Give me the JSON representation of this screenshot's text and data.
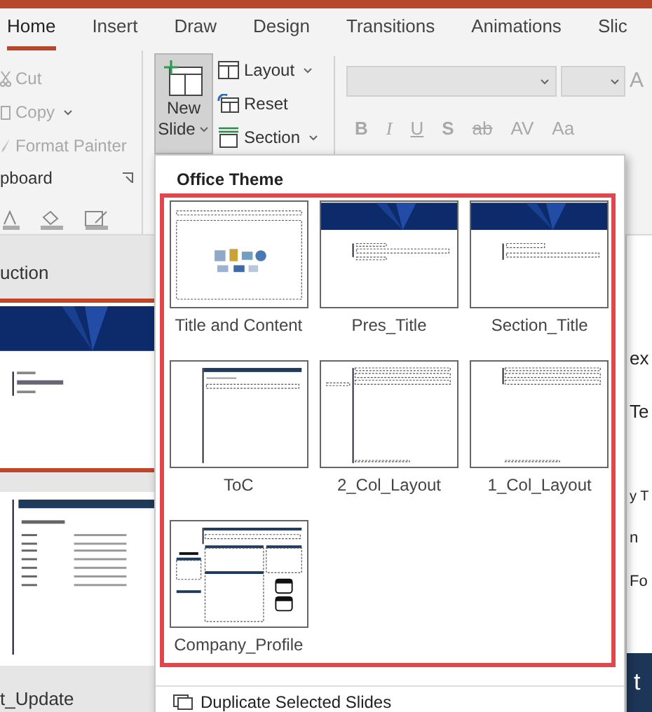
{
  "tabs": [
    {
      "label": "Home",
      "selected": true
    },
    {
      "label": "Insert",
      "selected": false
    },
    {
      "label": "Draw",
      "selected": false
    },
    {
      "label": "Design",
      "selected": false
    },
    {
      "label": "Transitions",
      "selected": false
    },
    {
      "label": "Animations",
      "selected": false
    },
    {
      "label": "Slic",
      "selected": false
    }
  ],
  "clipboard": {
    "items": [
      {
        "kind": "cut",
        "label": "Cut",
        "disabled": true,
        "caret": false
      },
      {
        "kind": "copy",
        "label": "Copy",
        "disabled": true,
        "caret": true
      },
      {
        "kind": "painter",
        "label": "Format Painter",
        "disabled": true,
        "caret": false
      }
    ],
    "group_label": "pboard"
  },
  "slides_group": {
    "new_slide": {
      "label": "New",
      "label2": "Slide",
      "expanded": true
    },
    "items": [
      {
        "kind": "layout",
        "label": "Layout"
      },
      {
        "kind": "reset",
        "label": "Reset"
      },
      {
        "kind": "section",
        "label": "Section"
      }
    ]
  },
  "font_group": {
    "disabled": true,
    "grow_label": "A",
    "buttons": [
      {
        "label": "B"
      },
      {
        "label": "I"
      },
      {
        "label": "U"
      },
      {
        "label": "S"
      },
      {
        "label": "ab"
      },
      {
        "label": "AV"
      },
      {
        "label": "Aa"
      }
    ]
  },
  "slide_panel": {
    "section_labels": [
      "uction",
      "t_Update"
    ],
    "slides": [
      {
        "kind": "title",
        "selected": true
      },
      {
        "kind": "toc",
        "selected": false
      }
    ]
  },
  "editor_edge": {
    "texts": [
      "ex",
      "Te",
      "y T",
      "n",
      "Fo"
    ],
    "banner_text": "t"
  },
  "menu": {
    "heading": "Office Theme",
    "layouts": [
      {
        "kind": "title_content",
        "label": "Title and Content"
      },
      {
        "kind": "pres_title",
        "label": "Pres_Title"
      },
      {
        "kind": "section_title",
        "label": "Section_Title"
      },
      {
        "kind": "toc",
        "label": "ToC"
      },
      {
        "kind": "two_col",
        "label": "2_Col_Layout"
      },
      {
        "kind": "one_col",
        "label": "1_Col_Layout"
      },
      {
        "kind": "company_profile",
        "label": "Company_Profile"
      }
    ],
    "commands": [
      "Duplicate Selected Slides"
    ]
  }
}
